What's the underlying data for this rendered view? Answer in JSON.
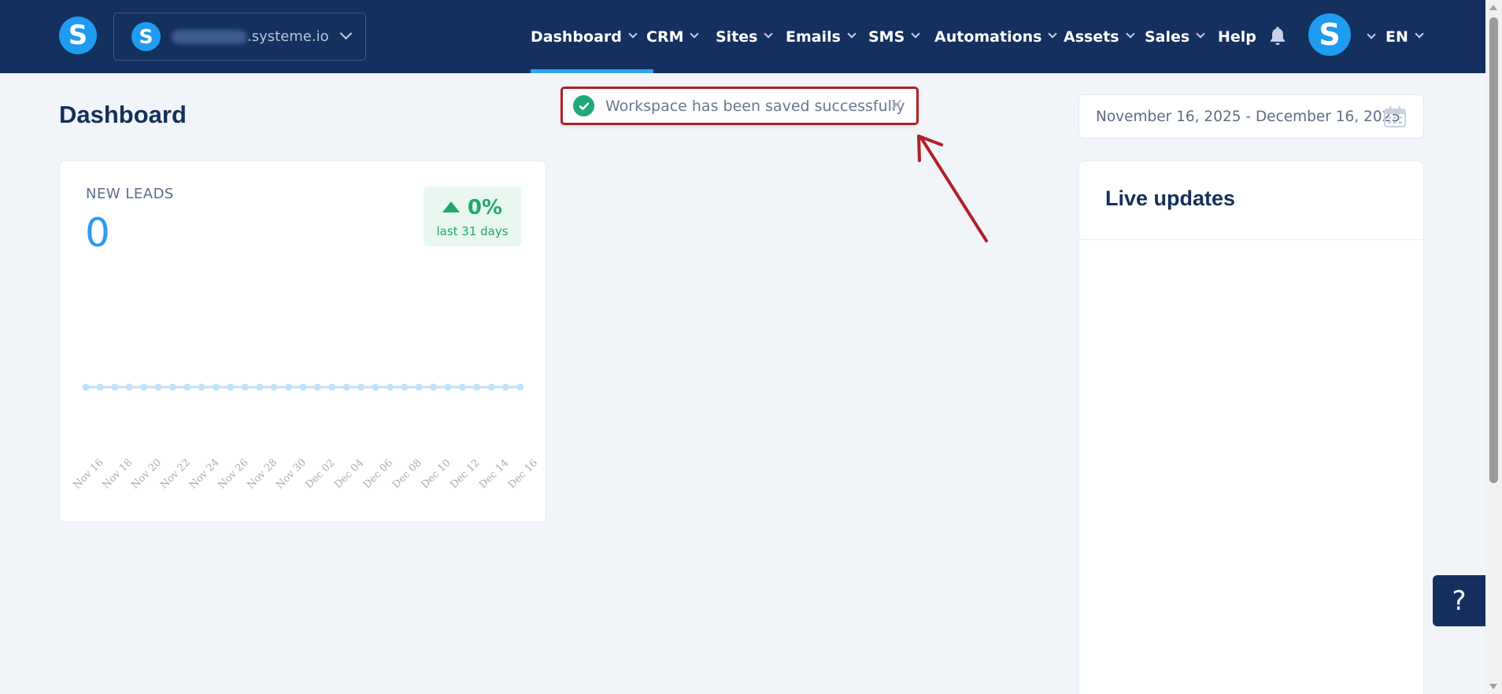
{
  "brand": {
    "logo_letter": "S",
    "accent": "#1f9bf0",
    "nav_bg": "#13305f"
  },
  "workspace": {
    "domain": ".systeme.io",
    "logo_letter": "S"
  },
  "nav": {
    "items": [
      {
        "label": "Dashboard",
        "has_dropdown": true,
        "active": true
      },
      {
        "label": "CRM",
        "has_dropdown": true
      },
      {
        "label": "Sites",
        "has_dropdown": true
      },
      {
        "label": "Emails",
        "has_dropdown": true
      },
      {
        "label": "SMS",
        "has_dropdown": true
      },
      {
        "label": "Automations",
        "has_dropdown": true
      },
      {
        "label": "Assets",
        "has_dropdown": true
      },
      {
        "label": "Sales",
        "has_dropdown": true
      },
      {
        "label": "Help",
        "has_dropdown": false
      }
    ],
    "avatar_letter": "S",
    "language": "EN"
  },
  "page": {
    "title": "Dashboard"
  },
  "date_range": {
    "value": "November 16, 2025 - December 16, 2025"
  },
  "toast": {
    "message": "Workspace has been saved successfully",
    "close": "×",
    "status_color": "#1fa878"
  },
  "leads": {
    "label": "NEW LEADS",
    "value": "0",
    "growth": "0%",
    "growth_period": "last 31 days"
  },
  "chart_data": {
    "type": "line",
    "x": [
      "Nov 16",
      "Nov 17",
      "Nov 18",
      "Nov 19",
      "Nov 20",
      "Nov 21",
      "Nov 22",
      "Nov 23",
      "Nov 24",
      "Nov 25",
      "Nov 26",
      "Nov 27",
      "Nov 28",
      "Nov 29",
      "Nov 30",
      "Dec 01",
      "Dec 02",
      "Dec 03",
      "Dec 04",
      "Dec 05",
      "Dec 06",
      "Dec 07",
      "Dec 08",
      "Dec 09",
      "Dec 10",
      "Dec 11",
      "Dec 12",
      "Dec 13",
      "Dec 14",
      "Dec 15",
      "Dec 16"
    ],
    "tick_labels": [
      "Nov 16",
      "Nov 18",
      "Nov 20",
      "Nov 22",
      "Nov 24",
      "Nov 26",
      "Nov 28",
      "Nov 30",
      "Dec 02",
      "Dec 04",
      "Dec 06",
      "Dec 08",
      "Dec 10",
      "Dec 12",
      "Dec 14",
      "Dec 16"
    ],
    "series": [
      {
        "values": [
          0,
          0,
          0,
          0,
          0,
          0,
          0,
          0,
          0,
          0,
          0,
          0,
          0,
          0,
          0,
          0,
          0,
          0,
          0,
          0,
          0,
          0,
          0,
          0,
          0,
          0,
          0,
          0,
          0,
          0,
          0
        ]
      }
    ],
    "grid": false,
    "color": "#bfe3f8"
  },
  "live_updates": {
    "title": "Live updates"
  },
  "help_button": {
    "label": "?"
  }
}
